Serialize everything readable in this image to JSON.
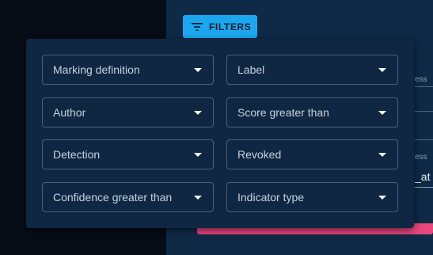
{
  "toolbar": {
    "filters_label": "FILTERS",
    "filters_icon": "filter-list-icon"
  },
  "background": {
    "label_top": "ess",
    "label_mid": "ess",
    "value_text": "_at"
  },
  "filters": [
    {
      "label": "Marking definition"
    },
    {
      "label": "Label"
    },
    {
      "label": "Author"
    },
    {
      "label": "Score greater than"
    },
    {
      "label": "Detection"
    },
    {
      "label": "Revoked"
    },
    {
      "label": "Confidence greater than"
    },
    {
      "label": "Indicator type"
    }
  ],
  "colors": {
    "accent": "#1ba7f0",
    "panel": "#0e2a47",
    "popover": "#0f2743",
    "danger": "#e9477e"
  }
}
